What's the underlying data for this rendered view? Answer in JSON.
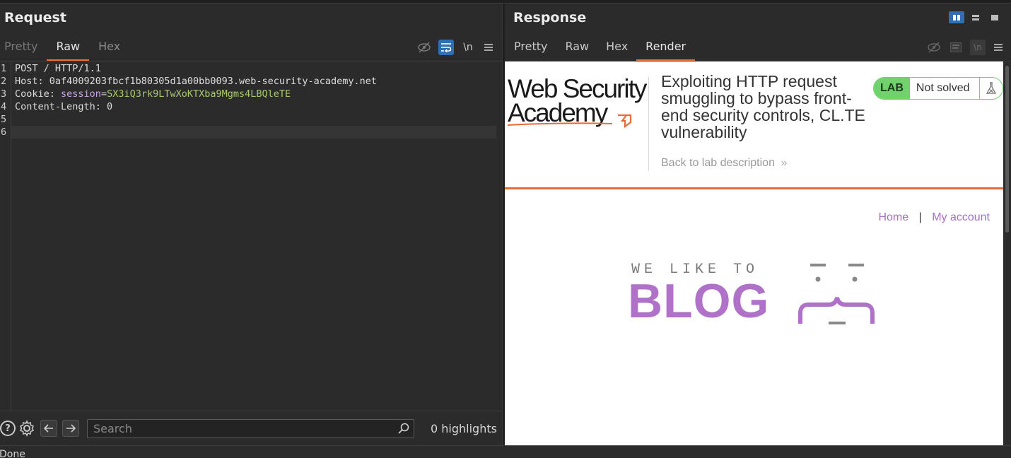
{
  "request": {
    "title": "Request",
    "tabs": [
      "Pretty",
      "Raw",
      "Hex"
    ],
    "active_tab": "Raw",
    "tools": {
      "newline": "\\n"
    },
    "line_numbers": [
      "1",
      "2",
      "3",
      "4",
      "5",
      "6"
    ],
    "lines": {
      "l1": "POST / HTTP/1.1",
      "l2": "Host: 0af4009203fbcf1b80305d1a00bb0093.web-security-academy.net",
      "l3_key": "Cookie: ",
      "l3_name": "session",
      "l3_eq": "=",
      "l3_value": "SX3iQ3rk9LTwXoKTXba9Mgms4LBQleTE",
      "l4": "Content-Length: 0",
      "l5": "",
      "l6": ""
    },
    "search": {
      "placeholder": "Search",
      "value": ""
    },
    "highlights": "0 highlights"
  },
  "response": {
    "title": "Response",
    "tabs": [
      "Pretty",
      "Raw",
      "Hex",
      "Render"
    ],
    "active_tab": "Render",
    "tools": {
      "newline": "\\n"
    },
    "render": {
      "logo_line1": "Web Security",
      "logo_line2": "Academy",
      "lab_title": "Exploiting HTTP request smuggling to bypass front-end security controls, CL.TE vulnerability",
      "back_link": "Back to lab description",
      "back_chevron": "»",
      "badge_lab": "LAB",
      "badge_status": "Not solved",
      "nav_home": "Home",
      "nav_sep": "|",
      "nav_account": "My account",
      "blog_tagline": "WE LIKE TO",
      "blog_word": "BLOG"
    }
  },
  "status": {
    "text": "Done"
  },
  "colors": {
    "accent": "#e8703a",
    "toggle_blue": "#2f6fb3",
    "lab_green": "#70d16d",
    "blog_purple": "#b072c8",
    "link_purple": "#a66dc7",
    "rule_orange": "#ec6933"
  }
}
